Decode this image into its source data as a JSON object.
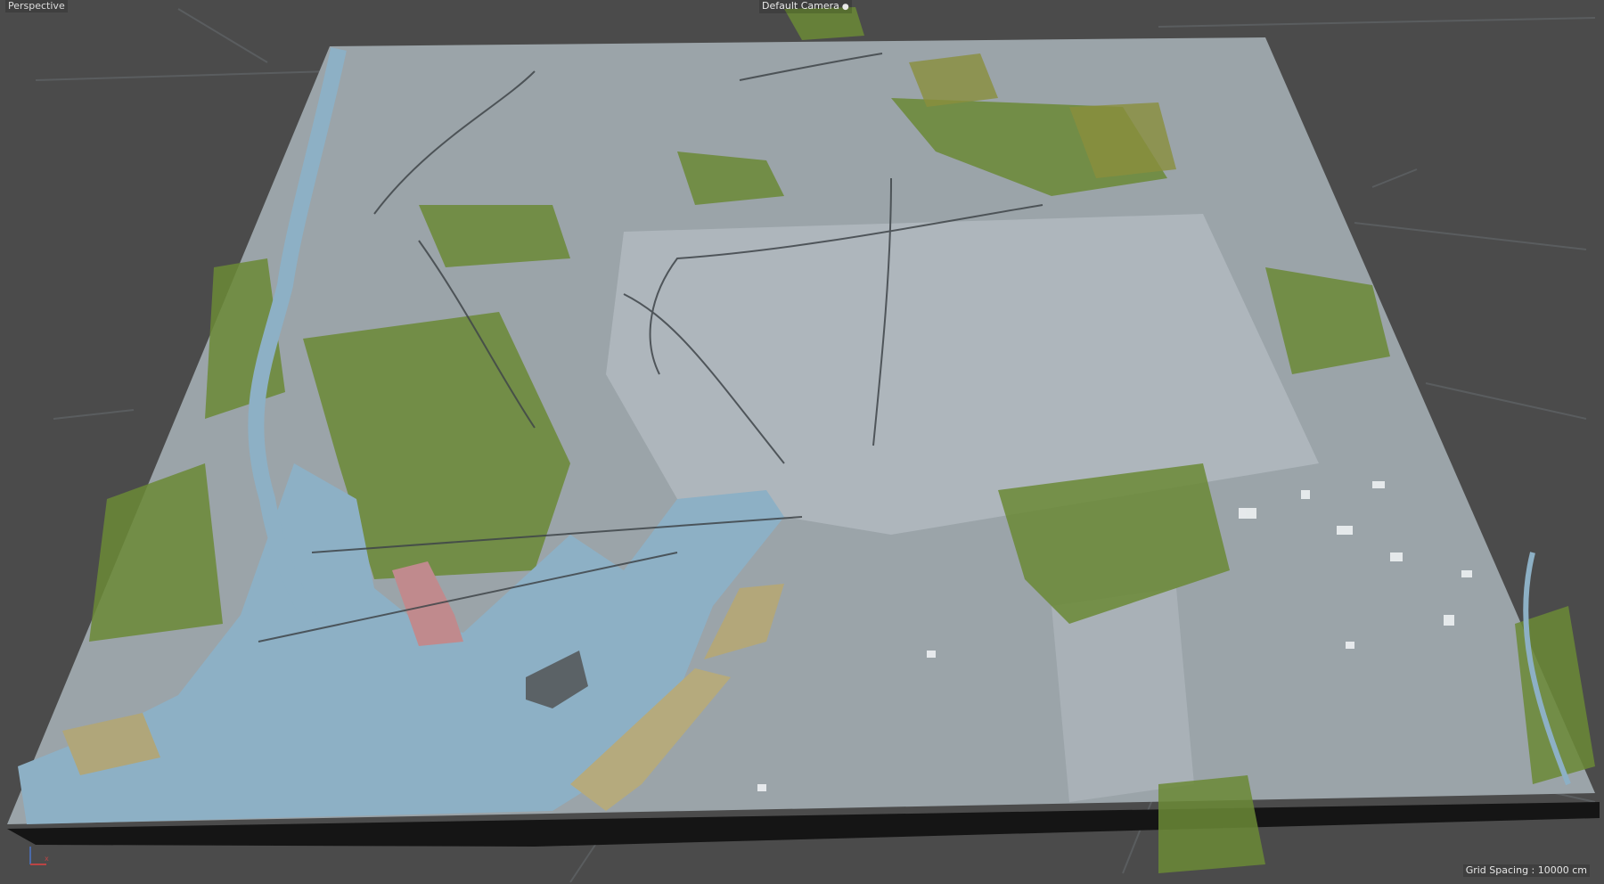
{
  "viewport": {
    "view_name": "Perspective",
    "camera_name": "Default Camera",
    "camera_icon": "camera-icon",
    "grid_spacing_text": "Grid Spacing : 10000 cm"
  },
  "colors": {
    "background": "#4b4b4b",
    "water": "#8fb0c4",
    "land": "#9aa3a8",
    "vegetation": "#6f8a3c",
    "urban": "#b7bfc6",
    "reclaimed": "#b3a77a"
  }
}
